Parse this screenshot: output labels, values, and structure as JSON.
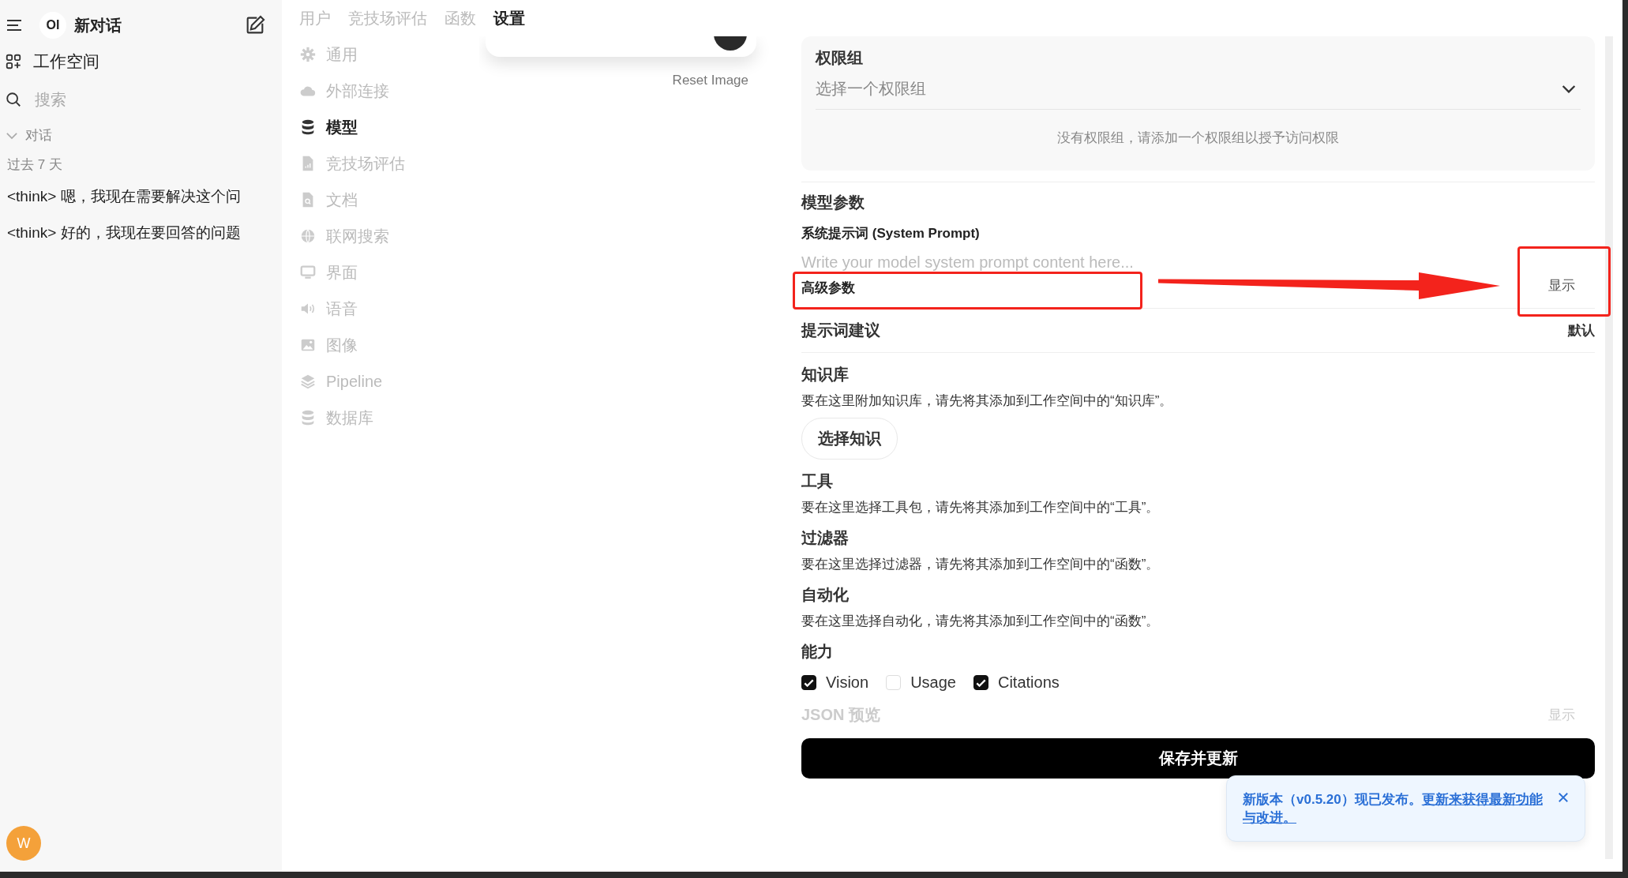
{
  "sidebar": {
    "title": "新对话",
    "logo": "OI",
    "workspace": "工作空间",
    "search": {
      "placeholder": "搜索"
    },
    "section": {
      "label": "对话",
      "expanded": true
    },
    "group": "过去 7 天",
    "chats": [
      {
        "title": "<think> 嗯，我现在需要解决这个问"
      },
      {
        "title": "<think> 好的，我现在要回答的问题"
      }
    ],
    "user": {
      "initial": "W"
    }
  },
  "tabs": [
    {
      "label": "用户",
      "selected": false
    },
    {
      "label": "竞技场评估",
      "selected": false
    },
    {
      "label": "函数",
      "selected": false
    },
    {
      "label": "设置",
      "selected": true
    }
  ],
  "settings_menu": [
    {
      "label": "通用",
      "selected": false
    },
    {
      "label": "外部连接",
      "selected": false
    },
    {
      "label": "模型",
      "selected": true
    },
    {
      "label": "竞技场评估",
      "selected": false
    },
    {
      "label": "文档",
      "selected": false
    },
    {
      "label": "联网搜索",
      "selected": false
    },
    {
      "label": "界面",
      "selected": false
    },
    {
      "label": "语音",
      "selected": false
    },
    {
      "label": "图像",
      "selected": false
    },
    {
      "label": "Pipeline",
      "selected": false
    },
    {
      "label": "数据库",
      "selected": false
    }
  ],
  "image_card": {
    "reset_label": "Reset Image"
  },
  "form": {
    "access": {
      "title": "权限组",
      "select_placeholder": "选择一个权限组",
      "empty_message": "没有权限组，请添加一个权限组以授予访问权限"
    },
    "model_params": {
      "title": "模型参数",
      "system_prompt_label": "系统提示词 (System Prompt)",
      "system_prompt_placeholder": "Write your model system prompt content here...",
      "advanced": {
        "label": "高级参数",
        "toggle": "显示"
      }
    },
    "prompt_suggestions": {
      "label": "提示词建议",
      "value": "默认"
    },
    "sections": [
      {
        "kind": "knowledge",
        "title": "知识库",
        "description": "要在这里附加知识库，请先将其添加到工作空间中的“知识库”。",
        "button": "选择知识"
      },
      {
        "kind": "plain",
        "title": "工具",
        "description": "要在这里选择工具包，请先将其添加到工作空间中的“工具”。"
      },
      {
        "kind": "plain",
        "title": "过滤器",
        "description": "要在这里选择过滤器，请先将其添加到工作空间中的“函数”。"
      },
      {
        "kind": "plain",
        "title": "自动化",
        "description": "要在这里选择自动化，请先将其添加到工作空间中的“函数”。"
      }
    ],
    "capabilities": {
      "title": "能力",
      "items": [
        {
          "label": "Vision",
          "checked": true
        },
        {
          "label": "Usage",
          "checked": false
        },
        {
          "label": "Citations",
          "checked": true
        }
      ]
    },
    "json_preview": {
      "label": "JSON 预览",
      "toggle": "显示"
    },
    "save_button": "保存并更新"
  },
  "toast": {
    "message": "新版本（v0.5.20）现已发布。",
    "link": "更新来获得最新功能与改进。"
  }
}
